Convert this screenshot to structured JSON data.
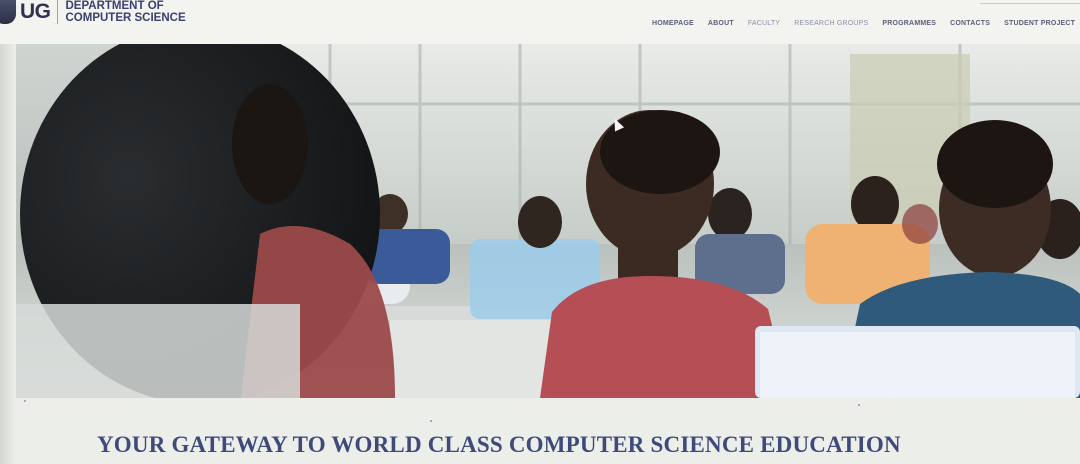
{
  "header": {
    "logo_mark": "UG",
    "dept_line1": "DEPARTMENT OF",
    "dept_line2": "COMPUTER SCIENCE"
  },
  "nav": {
    "items": [
      {
        "label": "HOMEPAGE"
      },
      {
        "label": "ABOUT"
      },
      {
        "label": "FACULTY"
      },
      {
        "label": "RESEARCH GROUPS"
      },
      {
        "label": "PROGRAMMES"
      },
      {
        "label": "CONTACTS"
      },
      {
        "label": "STUDENT PROJECT"
      }
    ]
  },
  "hero": {
    "image_description_icon": "students-in-computer-lab-photo"
  },
  "tagline": "YOUR GATEWAY TO WORLD CLASS COMPUTER SCIENCE EDUCATION",
  "colors": {
    "brand_navy": "#3f4a7a",
    "nav_text": "#5b6078",
    "page_bg": "#eceee9"
  }
}
